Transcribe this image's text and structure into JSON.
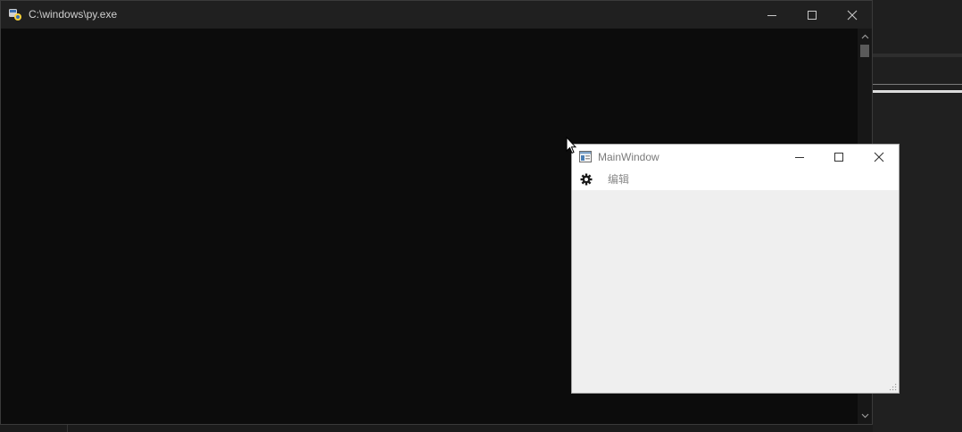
{
  "console": {
    "title": "C:\\windows\\py.exe",
    "icon": "python-launcher-icon",
    "buttons": {
      "minimize": "minimize-icon",
      "maximize": "maximize-icon",
      "close": "close-icon"
    }
  },
  "main_window": {
    "title": "MainWindow",
    "icon": "window-app-icon",
    "menu": {
      "settings_icon": "gear-icon",
      "edit_label": "编辑"
    },
    "buttons": {
      "minimize": "minimize-icon",
      "maximize": "maximize-icon",
      "close": "close-icon"
    }
  },
  "colors": {
    "console_bg": "#0c0c0c",
    "console_titlebar": "#202020",
    "main_window_bg": "#efefef",
    "main_window_titlebar": "#ffffff"
  }
}
